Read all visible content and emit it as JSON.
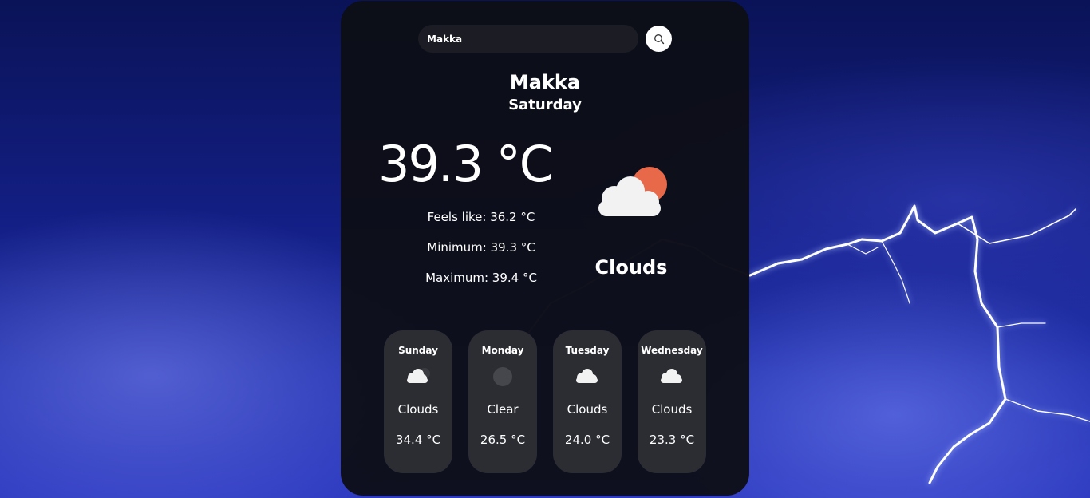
{
  "search": {
    "value": "Makka"
  },
  "current": {
    "city": "Makka",
    "day": "Saturday",
    "temperature": "39.3 °C",
    "feels_like": "Feels like: 36.2 °C",
    "minimum": "Minimum: 39.3 °C",
    "maximum": "Maximum: 39.4 °C",
    "condition": "Clouds",
    "icon": "cloud-sun-icon"
  },
  "forecast": [
    {
      "day": "Sunday",
      "condition": "Clouds",
      "temp": "34.4 °C",
      "icon": "cloud-icon"
    },
    {
      "day": "Monday",
      "condition": "Clear",
      "temp": "26.5 °C",
      "icon": "moon-icon"
    },
    {
      "day": "Tuesday",
      "condition": "Clouds",
      "temp": "24.0 °C",
      "icon": "cloud-icon"
    },
    {
      "day": "Wednesday",
      "condition": "Clouds",
      "temp": "23.3 °C",
      "icon": "cloud-icon"
    }
  ],
  "colors": {
    "sun": "#e8694a",
    "card": "#0d0e14",
    "forecast_card": "#2c2d33"
  }
}
